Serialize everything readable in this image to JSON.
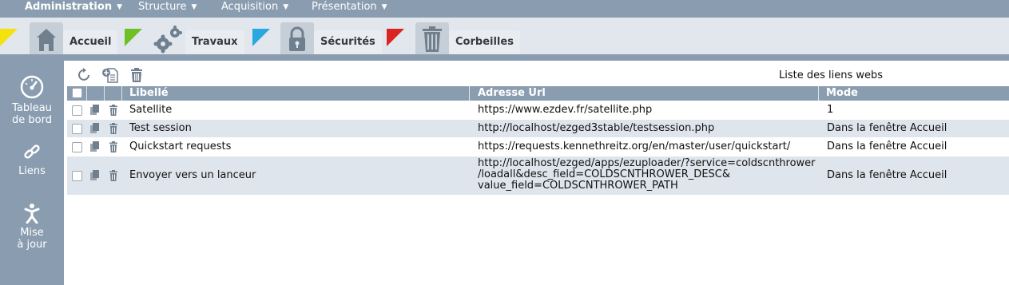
{
  "menu": {
    "items": [
      {
        "label": "Administration"
      },
      {
        "label": "Structure"
      },
      {
        "label": "Acquisition"
      },
      {
        "label": "Présentation"
      }
    ]
  },
  "tabs": [
    {
      "label": "Accueil",
      "flag_color": "#f5e20c",
      "icon": "home-icon"
    },
    {
      "label": "Travaux",
      "flag_color": "#6fbf27",
      "icon": "gears-icon"
    },
    {
      "label": "Sécurités",
      "flag_color": "#2aa6e0",
      "icon": "lock-icon"
    },
    {
      "label": "Corbeilles",
      "flag_color": "#d9241f",
      "icon": "trash-icon"
    }
  ],
  "sidebar": {
    "items": [
      {
        "label_line1": "Tableau",
        "label_line2": "de bord",
        "icon": "dashboard-gauge-icon"
      },
      {
        "label_line1": "Liens",
        "label_line2": "",
        "icon": "link-icon"
      },
      {
        "label_line1": "Mise",
        "label_line2": "à jour",
        "icon": "update-figure-icon"
      }
    ]
  },
  "toolbar": {
    "list_title": "Liste des liens webs",
    "icons": [
      "refresh-icon",
      "add-document-icon",
      "delete-icon"
    ]
  },
  "table": {
    "headers": {
      "label": "Libellé",
      "url": "Adresse Url",
      "mode": "Mode"
    },
    "rows": [
      {
        "label": "Satellite",
        "url_lines": [
          "https://www.ezdev.fr/satellite.php"
        ],
        "mode": "1"
      },
      {
        "label": "Test session",
        "url_lines": [
          "http://localhost/ezged3stable/testsession.php"
        ],
        "mode": "Dans la fenêtre Accueil"
      },
      {
        "label": "Quickstart requests",
        "url_lines": [
          "https://requests.kennethreitz.org/en/master/user/quickstart/"
        ],
        "mode": "Dans la fenêtre Accueil"
      },
      {
        "label": "Envoyer vers un lanceur",
        "url_lines": [
          "http://localhost/ezged/apps/ezuploader/?service=coldscnthrower",
          "/loadall&desc_field=COLDSCNTHROWER_DESC&",
          "value_field=COLDSCNTHROWER_PATH"
        ],
        "mode": "Dans la fenêtre Accueil"
      }
    ]
  },
  "colors": {
    "accent": "#8a9db0",
    "row_alt": "#dfe5ec",
    "tab_icon_bg": "#c6cfd7"
  }
}
